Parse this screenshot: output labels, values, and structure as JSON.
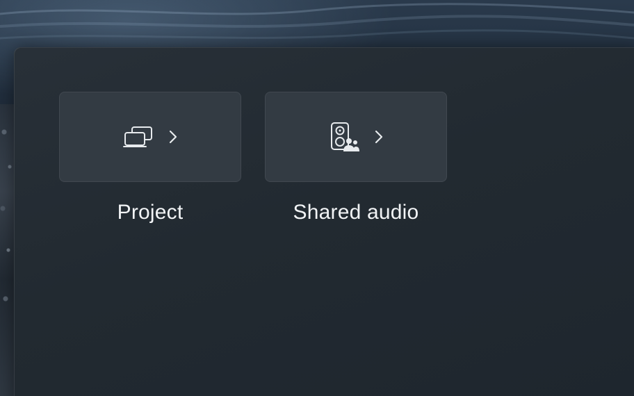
{
  "quick_settings": {
    "tiles": [
      {
        "id": "project",
        "label": "Project",
        "icon": "project-icon",
        "chevron": "chevron-right-icon"
      },
      {
        "id": "shared_audio",
        "label": "Shared audio",
        "icon": "shared-audio-icon",
        "chevron": "chevron-right-icon"
      }
    ]
  },
  "colors": {
    "panel_bg": "#222a31",
    "tile_bg": "#333b43",
    "text": "#f2f4f6"
  }
}
